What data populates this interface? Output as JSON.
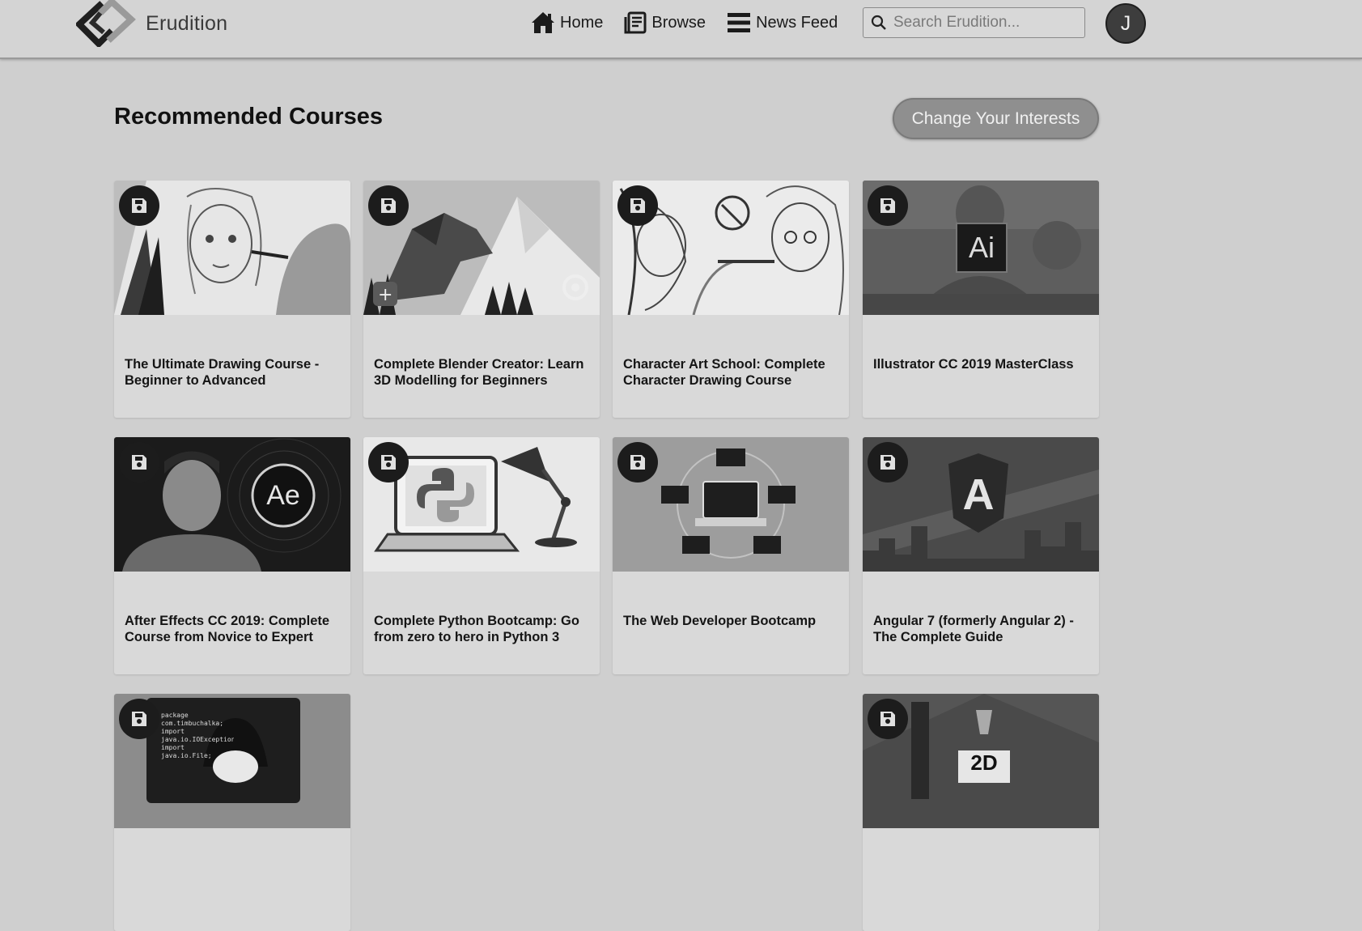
{
  "header": {
    "brand": "Erudition",
    "nav": [
      {
        "label": "Home",
        "icon": "home-icon"
      },
      {
        "label": "Browse",
        "icon": "book-icon"
      },
      {
        "label": "News Feed",
        "icon": "feed-icon"
      }
    ],
    "search_placeholder": "Search Erudition...",
    "avatar_initial": "J"
  },
  "main": {
    "title": "Recommended Courses",
    "change_interests_label": "Change Your Interests",
    "courses": [
      {
        "title": "The Ultimate Drawing Course - Beginner to Advanced"
      },
      {
        "title": "Complete Blender Creator: Learn 3D Modelling for Beginners"
      },
      {
        "title": "Character Art School: Complete Character Drawing Course"
      },
      {
        "title": "Illustrator CC 2019 MasterClass",
        "thumb_text": "Ai"
      },
      {
        "title": "After Effects CC 2019: Complete Course from Novice to Expert",
        "thumb_text": "Ae"
      },
      {
        "title": "Complete Python Bootcamp: Go from zero to hero in Python 3"
      },
      {
        "title": "The Web Developer Bootcamp"
      },
      {
        "title": "Angular 7 (formerly Angular 2) - The Complete Guide",
        "thumb_text": "A"
      },
      {
        "title": "",
        "thumb_text": "package com.timbuchalka; import java.io.IOException; import java.io.File; public class"
      },
      {
        "title": "",
        "thumb_text": "2D"
      }
    ]
  }
}
